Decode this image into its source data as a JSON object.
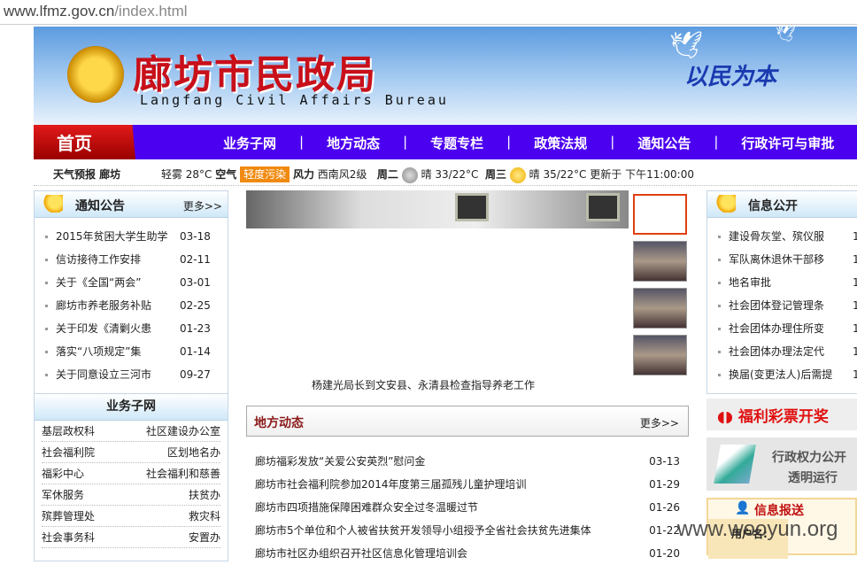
{
  "url": {
    "host": "www.lfmz.gov.cn",
    "path": "/index.html"
  },
  "banner": {
    "title": "廊坊市民政局",
    "subtitle": "Langfang Civil Affairs Bureau",
    "slogan": "以民为本"
  },
  "nav": {
    "home": "首页",
    "items": [
      "业务子网",
      "地方动态",
      "专题专栏",
      "政策法规",
      "通知公告",
      "行政许可与审批"
    ],
    "sep": "|"
  },
  "weather": {
    "label": "天气预报 廊坊",
    "now": "轻雾 28°C",
    "air_label": "空气",
    "air": "轻度污染",
    "wind_label": "风力",
    "wind": "西南风2级",
    "d1": "周二",
    "d1w": "晴 33/22°C",
    "d2": "周三",
    "d2w": "晴 35/22°C",
    "updated": "更新于 下午11:00:00"
  },
  "notice": {
    "title": "通知公告",
    "more": "更多>>",
    "items": [
      {
        "text": "2015年贫困大学生助学",
        "date": "03-18"
      },
      {
        "text": "信访接待工作安排",
        "date": "02-11"
      },
      {
        "text": "关于《全国“两会”",
        "date": "03-01"
      },
      {
        "text": "廊坊市养老服务补贴",
        "date": "02-25"
      },
      {
        "text": "关于印发《清剿火患",
        "date": "01-23"
      },
      {
        "text": "落实“八项规定”集",
        "date": "01-14"
      },
      {
        "text": "关于同意设立三河市",
        "date": "09-27"
      }
    ]
  },
  "subnet": {
    "title": "业务子网",
    "rows": [
      [
        "基层政权科",
        "社区建设办公室"
      ],
      [
        "社会福利院",
        "区划地名办"
      ],
      [
        "福彩中心",
        "社会福利和慈善"
      ],
      [
        "军休服务",
        "扶贫办"
      ],
      [
        "殡葬管理处",
        "救灾科"
      ],
      [
        "社会事务科",
        "安置办"
      ]
    ]
  },
  "slideshow": {
    "caption": "杨建光局长到文安县、永清县检查指导养老工作"
  },
  "local": {
    "title": "地方动态",
    "more": "更多>>",
    "items": [
      {
        "text": "廊坊福彩发放“关爱公安英烈”慰问金",
        "date": "03-13"
      },
      {
        "text": "廊坊市社会福利院参加2014年度第三届孤残儿童护理培训",
        "date": "01-29"
      },
      {
        "text": "廊坊市四项措施保障困难群众安全过冬温暖过节",
        "date": "01-26"
      },
      {
        "text": "廊坊市5个单位和个人被省扶贫开发领导小组授予全省社会扶贫先进集体",
        "date": "01-22"
      },
      {
        "text": "廊坊市社区办组织召开社区信息化管理培训会",
        "date": "01-20"
      }
    ]
  },
  "info": {
    "title": "信息公开",
    "items": [
      {
        "text": "建设骨灰堂、殡仪服",
        "date": "1"
      },
      {
        "text": "军队离休退休干部移",
        "date": "1"
      },
      {
        "text": "地名审批",
        "date": "1"
      },
      {
        "text": "社会团体登记管理条",
        "date": "1"
      },
      {
        "text": "社会团体办理住所变",
        "date": "1"
      },
      {
        "text": "社会团体办理法定代",
        "date": "1"
      },
      {
        "text": "换届(变更法人)后需提",
        "date": "1"
      }
    ]
  },
  "lottery": "福利彩票开奖",
  "power": {
    "line1": "行政权力公开",
    "line2": "透明运行"
  },
  "report": {
    "title": "信息报送",
    "username": "用户名:"
  },
  "watermark": "www.wooyun.org",
  "colors": {
    "nav": "#4c00f0",
    "home": "#d01010",
    "badge": "#f08a10"
  }
}
